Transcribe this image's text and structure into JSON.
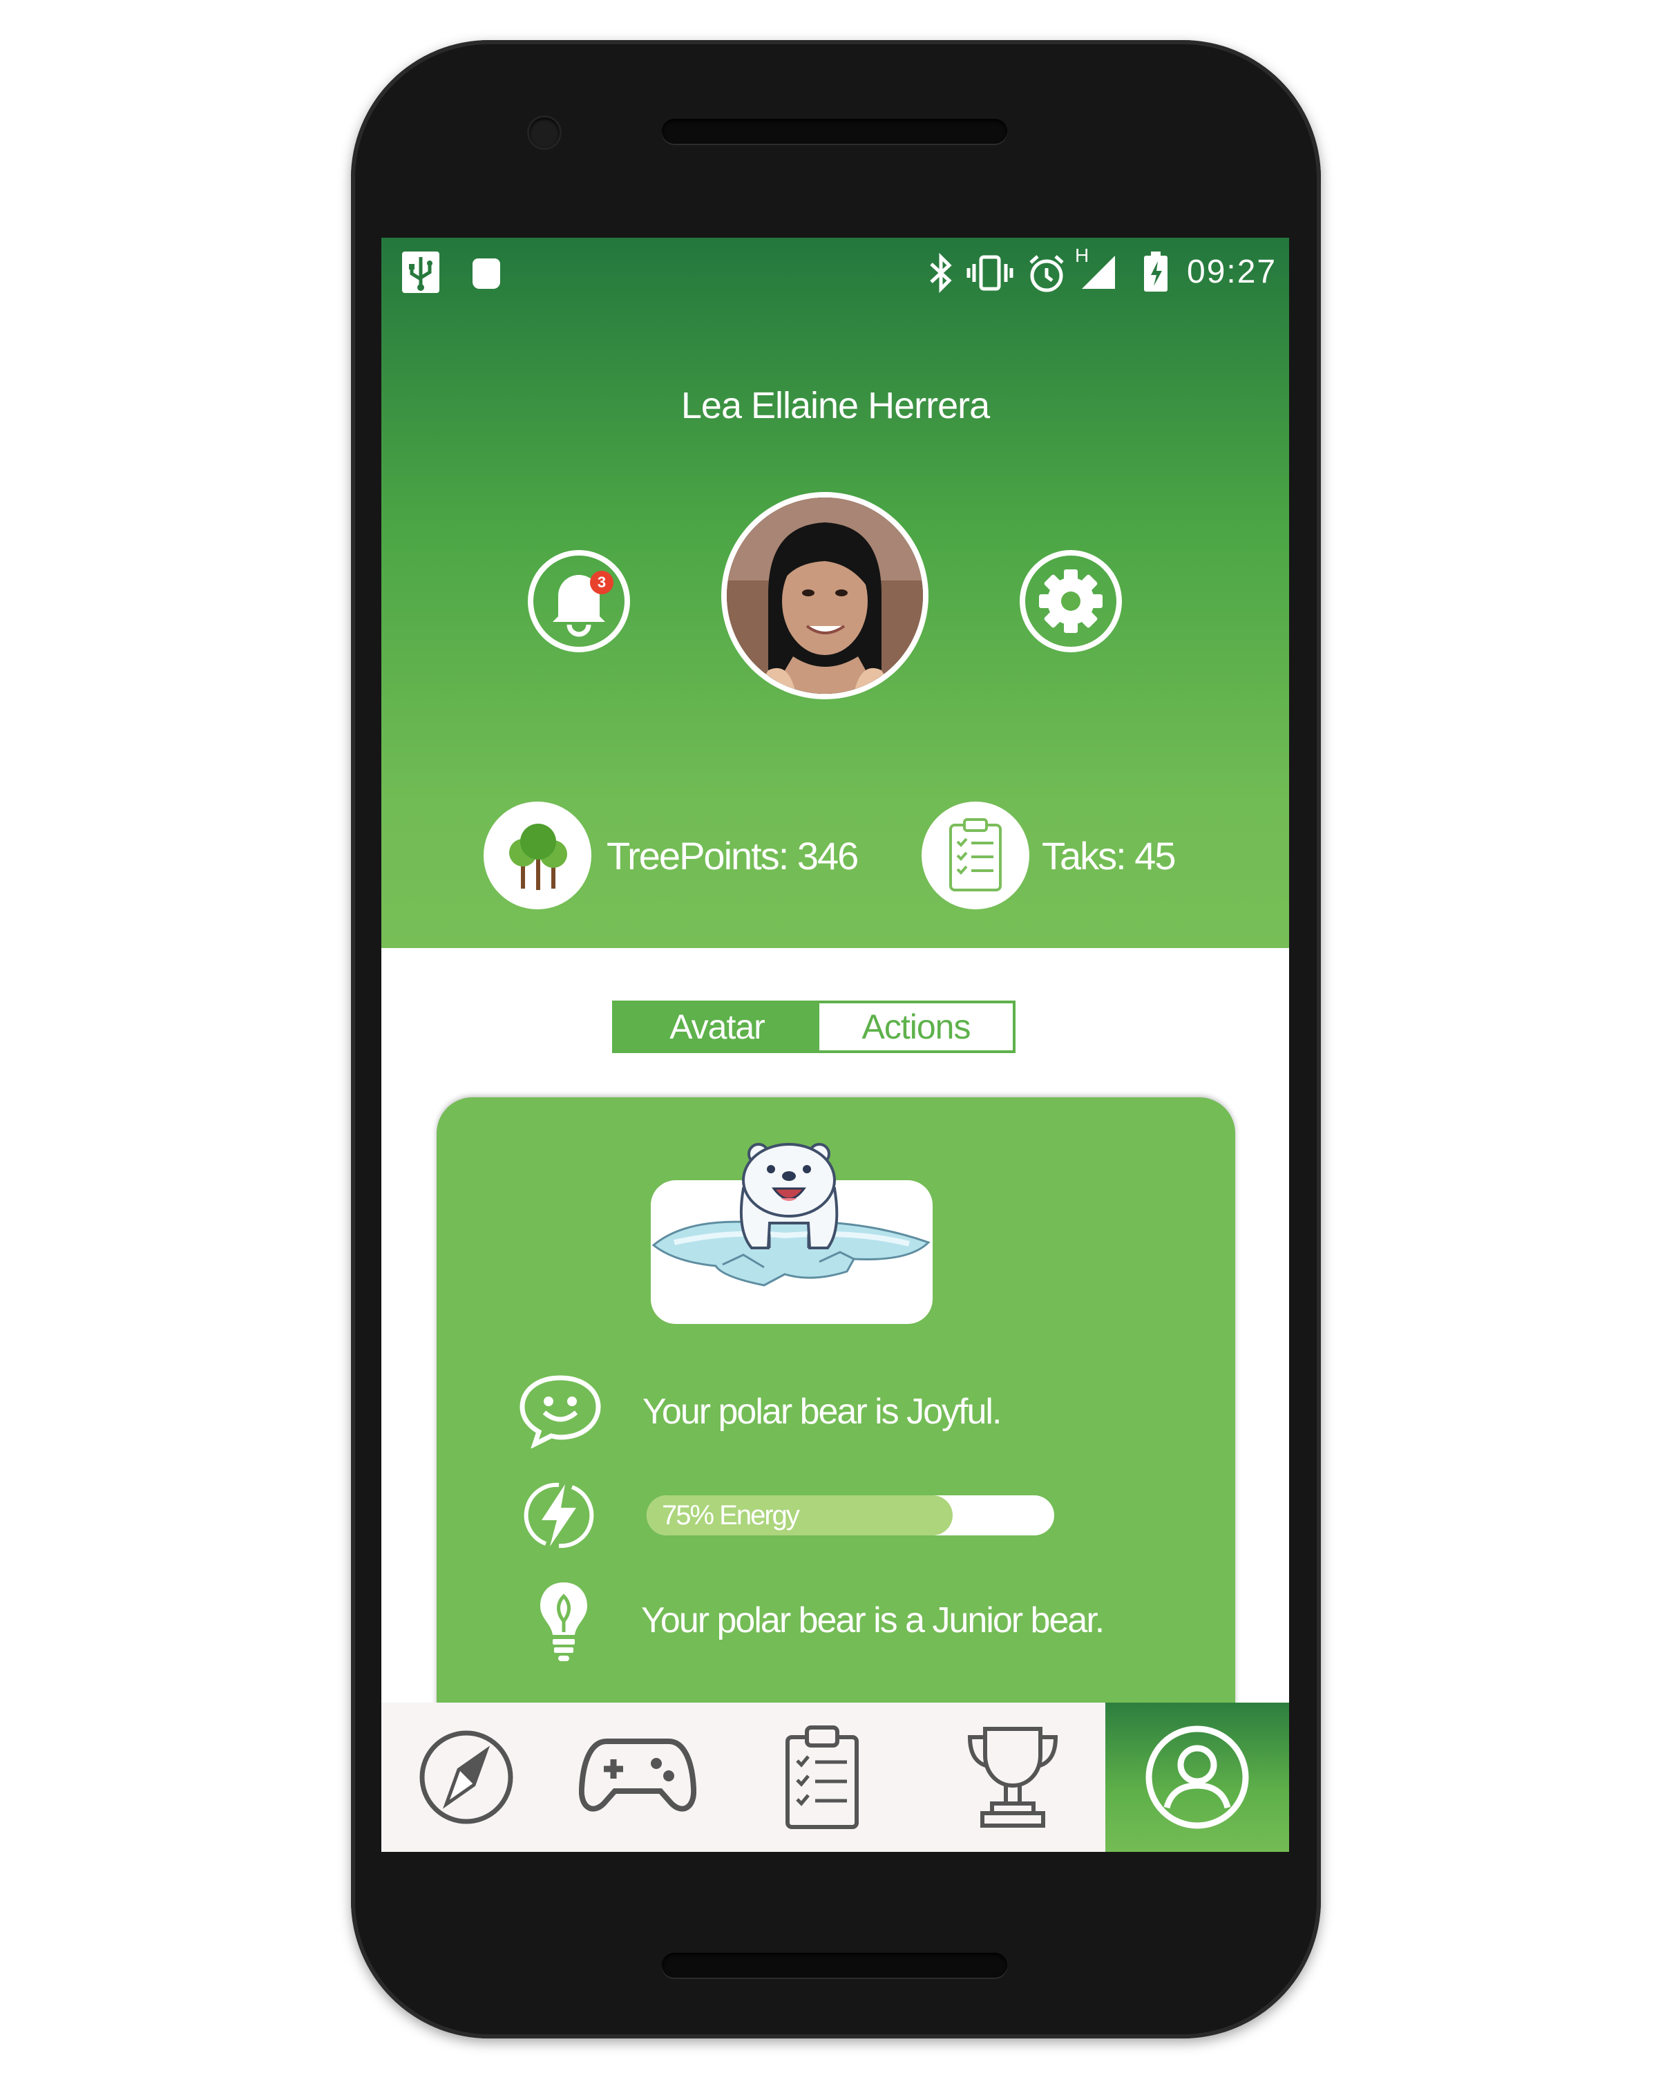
{
  "status_bar": {
    "time": "09:27",
    "network_label": "H",
    "icons": [
      "usb-icon",
      "android-icon",
      "bluetooth-icon",
      "vibrate-icon",
      "alarm-icon",
      "signal-icon",
      "battery-icon"
    ]
  },
  "profile": {
    "name": "Lea Ellaine Herrera",
    "notification_count": "3"
  },
  "stats": {
    "treepoints": "TreePoints: 346",
    "tasks": "Taks: 45"
  },
  "tabs": {
    "avatar": "Avatar",
    "actions": "Actions",
    "selected": "Avatar"
  },
  "bear": {
    "mood": "Your polar bear is Joyful.",
    "energy_label": "75% Energy",
    "energy_percent": 75,
    "rank": "Your polar bear is a Junior bear."
  },
  "nav": {
    "items": [
      "compass-icon",
      "gamepad-icon",
      "clipboard-icon",
      "trophy-icon",
      "profile-icon"
    ],
    "active": "profile-icon"
  },
  "colors": {
    "brand_green": "#74bc56",
    "dark_green": "#24773d",
    "badge_red": "#e8412c"
  }
}
